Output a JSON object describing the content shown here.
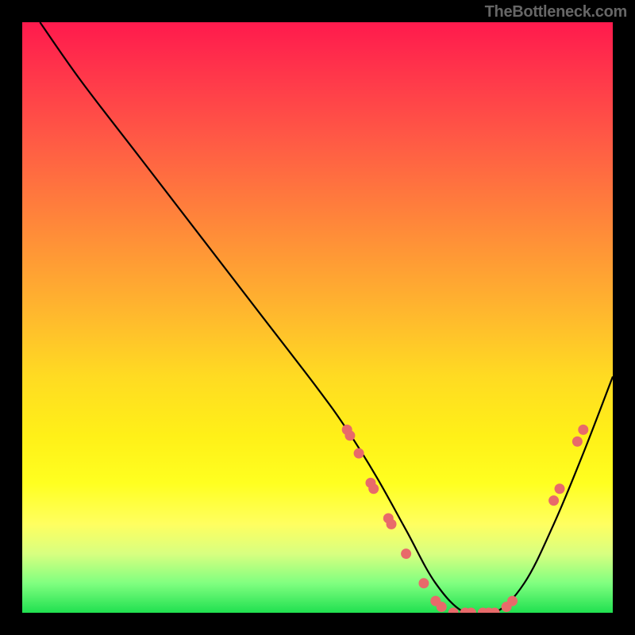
{
  "watermark": "TheBottleneck.com",
  "chart_data": {
    "type": "line",
    "title": "",
    "xlabel": "",
    "ylabel": "",
    "xlim": [
      0,
      100
    ],
    "ylim": [
      0,
      100
    ],
    "curve": {
      "name": "bottleneck-curve",
      "x": [
        3,
        10,
        20,
        30,
        40,
        50,
        55,
        60,
        65,
        70,
        75,
        80,
        85,
        90,
        95,
        100
      ],
      "y": [
        100,
        90,
        77,
        64,
        51,
        38,
        31,
        23,
        14,
        5,
        0,
        0,
        5,
        15,
        27,
        40
      ]
    },
    "markers": {
      "name": "data-points",
      "color": "#e86a6a",
      "points": [
        {
          "x": 55,
          "y": 31
        },
        {
          "x": 55.5,
          "y": 30
        },
        {
          "x": 57,
          "y": 27
        },
        {
          "x": 59,
          "y": 22
        },
        {
          "x": 59.5,
          "y": 21
        },
        {
          "x": 62,
          "y": 16
        },
        {
          "x": 62.5,
          "y": 15
        },
        {
          "x": 65,
          "y": 10
        },
        {
          "x": 68,
          "y": 5
        },
        {
          "x": 70,
          "y": 2
        },
        {
          "x": 71,
          "y": 1
        },
        {
          "x": 73,
          "y": 0
        },
        {
          "x": 75,
          "y": 0
        },
        {
          "x": 76,
          "y": 0
        },
        {
          "x": 78,
          "y": 0
        },
        {
          "x": 79,
          "y": 0
        },
        {
          "x": 80,
          "y": 0
        },
        {
          "x": 82,
          "y": 1
        },
        {
          "x": 83,
          "y": 2
        },
        {
          "x": 90,
          "y": 19
        },
        {
          "x": 91,
          "y": 21
        },
        {
          "x": 94,
          "y": 29
        },
        {
          "x": 95,
          "y": 31
        }
      ]
    }
  }
}
